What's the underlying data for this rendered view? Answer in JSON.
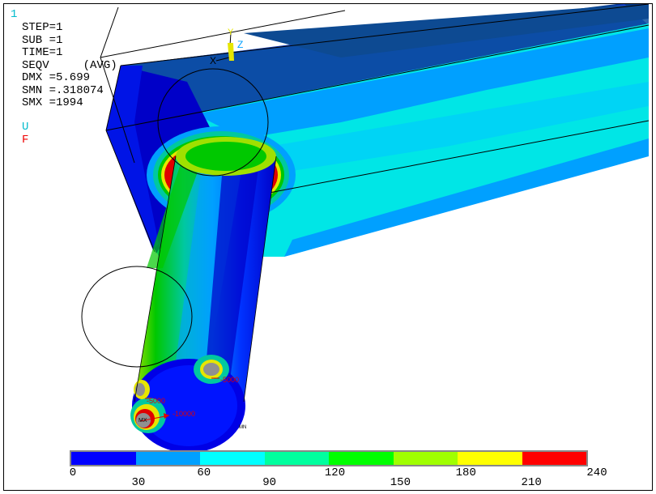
{
  "window_number": "1",
  "info_lines": {
    "step": "STEP=1",
    "sub": "SUB =1",
    "time": "TIME=1",
    "seqv": "SEQV     (AVG)",
    "dmx": "DMX =5.699",
    "smn": "SMN =.318074",
    "smx": "SMX =1994"
  },
  "legend_symbols": {
    "u": "U",
    "f": "F"
  },
  "triad": {
    "y": "Y",
    "z": "Z",
    "x": "X"
  },
  "annotations": {
    "force1": "-5000",
    "force2": "-10000",
    "force3": "-5000",
    "mx": "MX",
    "mn": "MN"
  },
  "colorbar": {
    "colors": [
      "#0000ff",
      "#00a0ff",
      "#00ffff",
      "#00ff9e",
      "#00ff00",
      "#a0ff00",
      "#ffff00",
      "#ff0000"
    ],
    "ticks_top": [
      "0",
      "60",
      "120",
      "180",
      "240"
    ],
    "ticks_bottom": [
      "30",
      "90",
      "150",
      "210"
    ]
  },
  "palette": {
    "deep_blue": "#0000c8",
    "blue": "#0032ff",
    "sky": "#00a0ff",
    "cyan": "#00e6e6",
    "teal": "#00c8a0",
    "green": "#00c800",
    "lime": "#a0e000",
    "yellow": "#e6e600",
    "red": "#e00000",
    "dark_navy": "#003c8c"
  }
}
